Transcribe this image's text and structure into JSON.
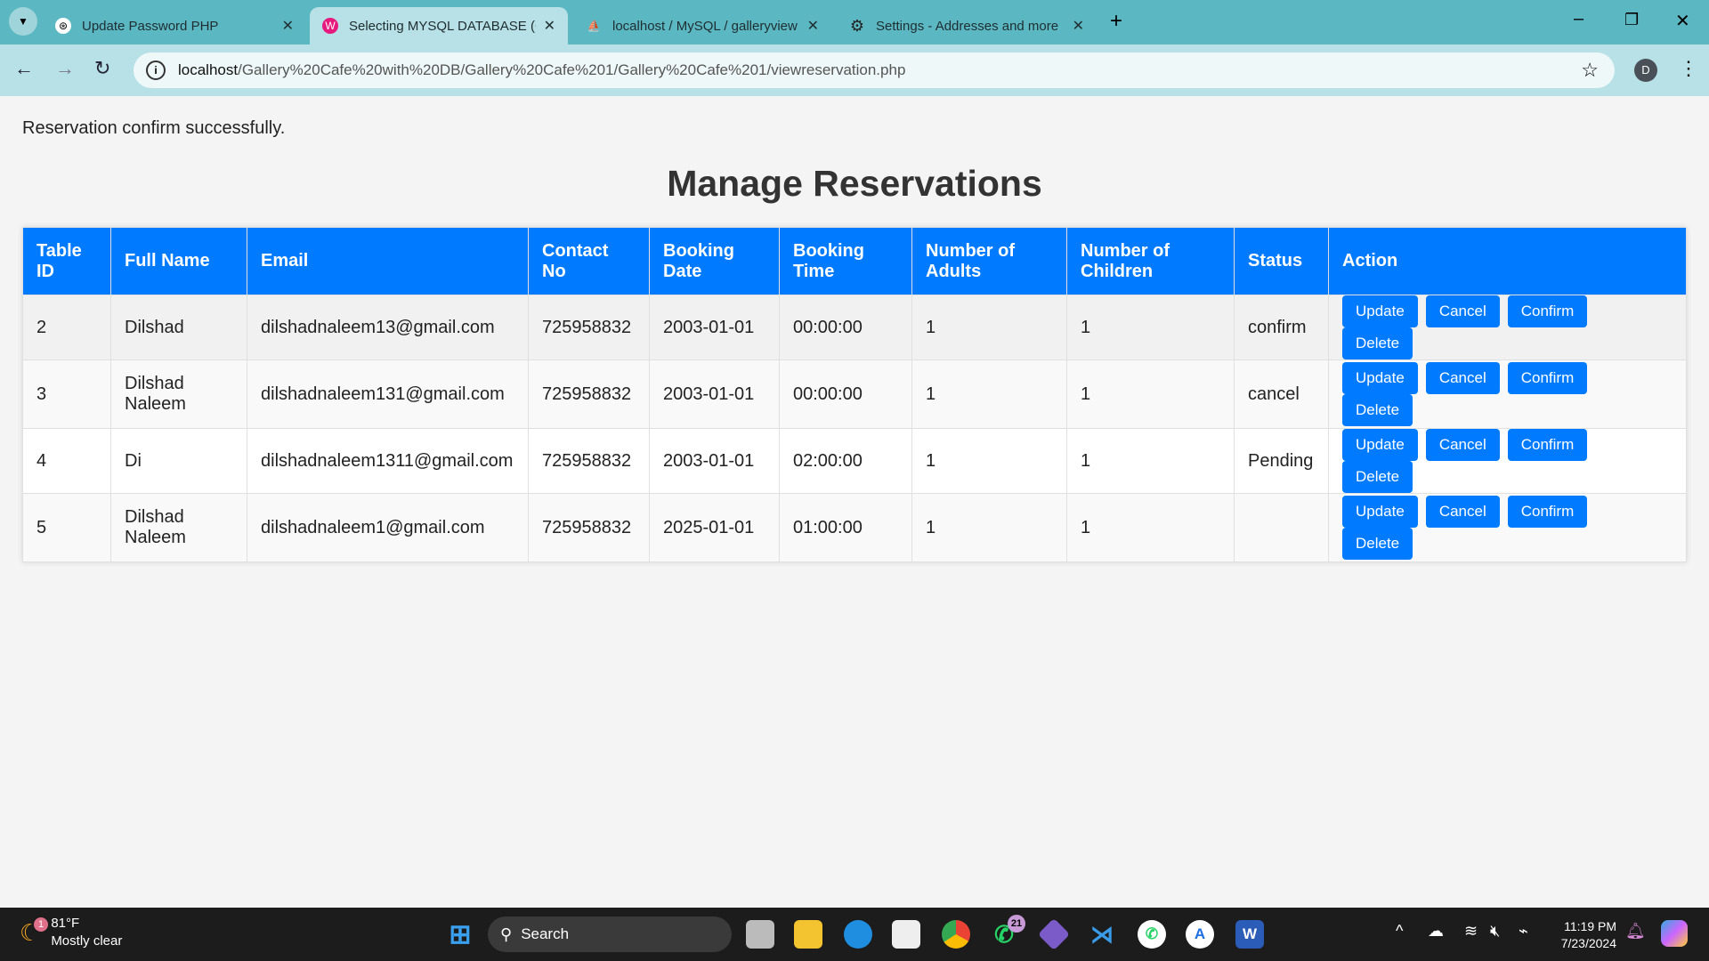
{
  "browser": {
    "tabs": [
      {
        "title": "Update Password PHP",
        "active": false
      },
      {
        "title": "Selecting MYSQL DATABASE (Gallery",
        "active": true
      },
      {
        "title": "localhost / MySQL / galleryview",
        "active": false
      },
      {
        "title": "Settings - Addresses and more",
        "active": false
      }
    ],
    "url_host": "localhost",
    "url_path": "/Gallery%20Cafe%20with%20DB/Gallery%20Cafe%201/Gallery%20Cafe%201/viewreservation.php",
    "profile_initial": "D"
  },
  "page": {
    "message": "Reservation confirm successfully.",
    "title": "Manage Reservations",
    "columns": [
      "Table ID",
      "Full Name",
      "Email",
      "Contact No",
      "Booking Date",
      "Booking Time",
      "Number of Adults",
      "Number of Children",
      "Status",
      "Action"
    ],
    "rows": [
      {
        "id": "2",
        "name": "Dilshad",
        "email": "dilshadnaleem13@gmail.com",
        "contact": "725958832",
        "date": "2003-01-01",
        "time": "00:00:00",
        "adults": "1",
        "children": "1",
        "status": "confirm"
      },
      {
        "id": "3",
        "name": "Dilshad Naleem",
        "email": "dilshadnaleem131@gmail.com",
        "contact": "725958832",
        "date": "2003-01-01",
        "time": "00:00:00",
        "adults": "1",
        "children": "1",
        "status": "cancel"
      },
      {
        "id": "4",
        "name": "Di",
        "email": "dilshadnaleem1311@gmail.com",
        "contact": "725958832",
        "date": "2003-01-01",
        "time": "02:00:00",
        "adults": "1",
        "children": "1",
        "status": "Pending"
      },
      {
        "id": "5",
        "name": "Dilshad Naleem",
        "email": "dilshadnaleem1@gmail.com",
        "contact": "725958832",
        "date": "2025-01-01",
        "time": "01:00:00",
        "adults": "1",
        "children": "1",
        "status": ""
      }
    ],
    "actions": [
      "Update",
      "Cancel",
      "Confirm",
      "Delete"
    ],
    "accent": "#007bff"
  },
  "taskbar": {
    "weather_temp": "81°F",
    "weather_desc": "Mostly clear",
    "weather_badge": "1",
    "search_label": "Search",
    "whatsapp_badge": "21",
    "time": "11:19 PM",
    "date": "7/23/2024"
  }
}
